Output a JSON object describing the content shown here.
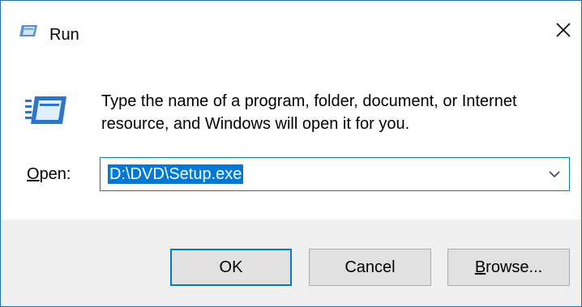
{
  "window": {
    "title": "Run",
    "close_glyph": "✕",
    "title_icon": "run-icon"
  },
  "main": {
    "icon": "run-icon",
    "description": "Type the name of a program, folder, document, or Internet resource, and Windows will open it for you.",
    "open_label_accel": "O",
    "open_label_rest": "pen:",
    "open_value": "D:\\DVD\\Setup.exe"
  },
  "buttons": {
    "ok": "OK",
    "cancel": "Cancel",
    "browse_accel": "B",
    "browse_rest": "rowse..."
  },
  "colors": {
    "accent": "#0078d7",
    "border": "#1f6fb7",
    "footer": "#f0f0f0",
    "button": "#e1e1e1"
  }
}
